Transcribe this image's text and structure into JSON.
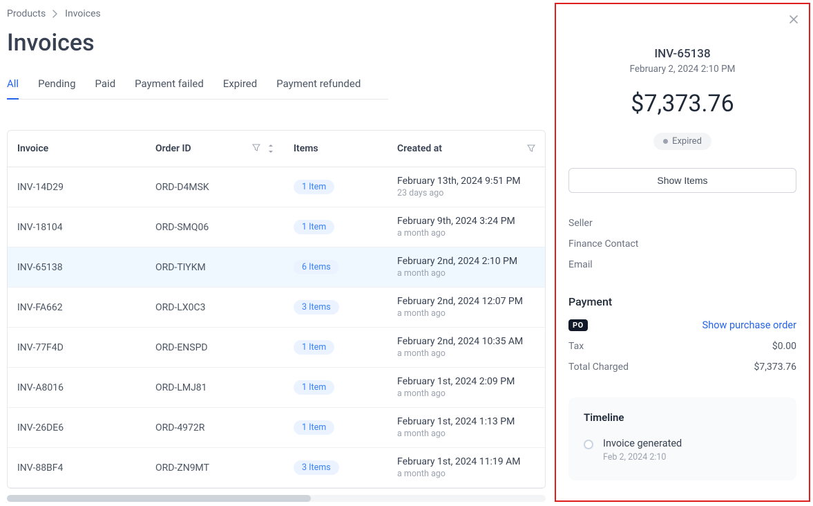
{
  "breadcrumb": {
    "root": "Products",
    "current": "Invoices"
  },
  "page_title": "Invoices",
  "tabs": [
    {
      "label": "All",
      "active": true
    },
    {
      "label": "Pending",
      "active": false
    },
    {
      "label": "Paid",
      "active": false
    },
    {
      "label": "Payment failed",
      "active": false
    },
    {
      "label": "Expired",
      "active": false
    },
    {
      "label": "Payment refunded",
      "active": false
    }
  ],
  "table": {
    "headers": {
      "invoice": "Invoice",
      "order": "Order ID",
      "items": "Items",
      "created": "Created at"
    },
    "rows": [
      {
        "invoice": "INV-14D29",
        "order": "ORD-D4MSK",
        "items": "1 Item",
        "created": "February 13th, 2024 9:51 PM",
        "ago": "23 days ago",
        "selected": false
      },
      {
        "invoice": "INV-18104",
        "order": "ORD-SMQ06",
        "items": "1 Item",
        "created": "February 9th, 2024 3:24 PM",
        "ago": "a month ago",
        "selected": false
      },
      {
        "invoice": "INV-65138",
        "order": "ORD-TIYKM",
        "items": "6 Items",
        "created": "February 2nd, 2024 2:10 PM",
        "ago": "a month ago",
        "selected": true
      },
      {
        "invoice": "INV-FA662",
        "order": "ORD-LX0C3",
        "items": "3 Items",
        "created": "February 2nd, 2024 12:07 PM",
        "ago": "a month ago",
        "selected": false
      },
      {
        "invoice": "INV-77F4D",
        "order": "ORD-ENSPD",
        "items": "1 Item",
        "created": "February 2nd, 2024 10:35 AM",
        "ago": "a month ago",
        "selected": false
      },
      {
        "invoice": "INV-A8016",
        "order": "ORD-LMJ81",
        "items": "1 Item",
        "created": "February 1st, 2024 2:09 PM",
        "ago": "a month ago",
        "selected": false
      },
      {
        "invoice": "INV-26DE6",
        "order": "ORD-4972R",
        "items": "1 Item",
        "created": "February 1st, 2024 1:13 PM",
        "ago": "a month ago",
        "selected": false
      },
      {
        "invoice": "INV-88BF4",
        "order": "ORD-ZN9MT",
        "items": "3 Items",
        "created": "February 1st, 2024 11:19 AM",
        "ago": "a month ago",
        "selected": false
      }
    ]
  },
  "panel": {
    "invoice_id": "INV-65138",
    "date": "February 2, 2024 2:10 PM",
    "amount": "$7,373.76",
    "status": "Expired",
    "show_items_label": "Show Items",
    "meta": {
      "seller": "Seller",
      "finance": "Finance Contact",
      "email": "Email"
    },
    "payment": {
      "title": "Payment",
      "po_badge": "PO",
      "po_link": "Show purchase order",
      "tax_label": "Tax",
      "tax_value": "$0.00",
      "total_label": "Total Charged",
      "total_value": "$7,373.76"
    },
    "timeline": {
      "title": "Timeline",
      "items": [
        {
          "title": "Invoice generated",
          "date": "Feb 2, 2024 2:10"
        }
      ]
    }
  }
}
